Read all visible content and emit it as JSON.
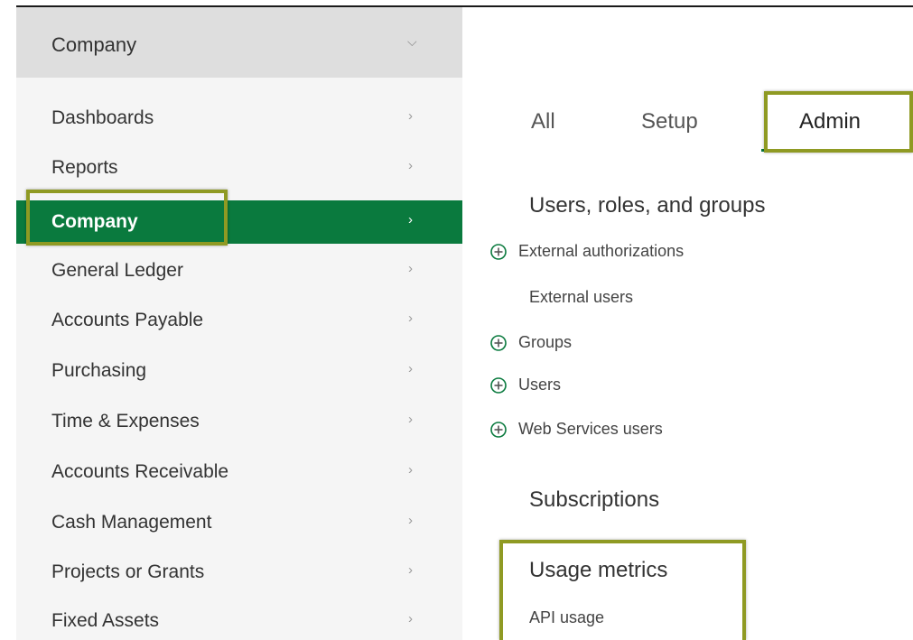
{
  "colors": {
    "accent": "#0a7a3e",
    "highlight_border": "#8f9a23",
    "sidebar_bg": "#f5f5f5",
    "sidebar_header_bg": "#dedede"
  },
  "sidebar": {
    "header": {
      "label": "Company",
      "icon": "chevron-down-icon"
    },
    "items": [
      {
        "label": "Dashboards",
        "active": false
      },
      {
        "label": "Reports",
        "active": false
      },
      {
        "label": "Company",
        "active": true
      },
      {
        "label": "General Ledger",
        "active": false
      },
      {
        "label": "Accounts Payable",
        "active": false
      },
      {
        "label": "Purchasing",
        "active": false
      },
      {
        "label": "Time & Expenses",
        "active": false
      },
      {
        "label": "Accounts Receivable",
        "active": false
      },
      {
        "label": "Cash Management",
        "active": false
      },
      {
        "label": "Projects or Grants",
        "active": false
      },
      {
        "label": "Fixed Assets",
        "active": false
      }
    ],
    "item_icon": "chevron-right-icon"
  },
  "main": {
    "tabs": [
      {
        "label": "All",
        "active": false
      },
      {
        "label": "Setup",
        "active": false
      },
      {
        "label": "Admin",
        "active": true
      }
    ],
    "sections": [
      {
        "title": "Users, roles, and groups",
        "items": [
          {
            "label": "External authorizations",
            "expandable": true
          },
          {
            "label": "External users",
            "expandable": false
          },
          {
            "label": "Groups",
            "expandable": true
          },
          {
            "label": "Users",
            "expandable": true
          },
          {
            "label": "Web Services users",
            "expandable": true
          }
        ]
      },
      {
        "title": "Subscriptions",
        "items": []
      },
      {
        "title": "Usage metrics",
        "items": [
          {
            "label": "API usage",
            "expandable": false
          }
        ]
      }
    ],
    "expand_icon": "plus-circle-icon"
  }
}
